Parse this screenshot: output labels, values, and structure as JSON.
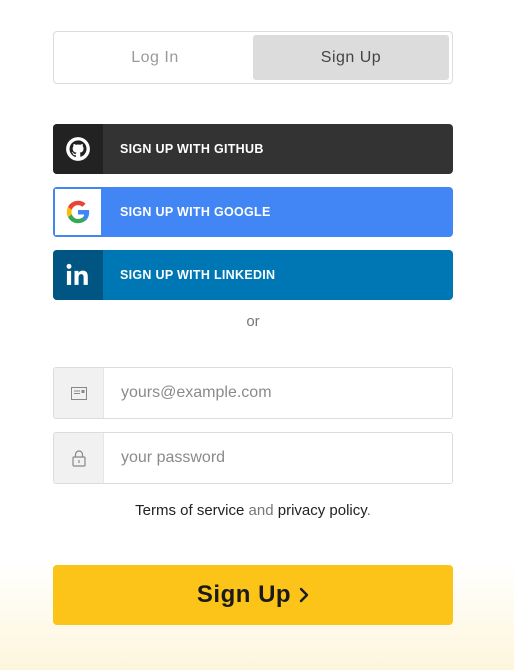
{
  "tabs": {
    "login": "Log In",
    "signup": "Sign Up"
  },
  "social": {
    "github": "SIGN UP WITH GITHUB",
    "google": "SIGN UP WITH GOOGLE",
    "linkedin": "SIGN UP WITH LINKEDIN",
    "icons": [
      "github-icon",
      "google-icon",
      "linkedin-icon"
    ],
    "colors": {
      "github": "#333333",
      "google": "#4285f4",
      "linkedin": "#0077b5"
    }
  },
  "separator": "or",
  "form": {
    "email_placeholder": "yours@example.com",
    "password_placeholder": "your password",
    "email_value": "",
    "password_value": ""
  },
  "terms": {
    "tos": "Terms of service",
    "and": " and ",
    "privacy": "privacy policy",
    "period": "."
  },
  "submit": {
    "label": "Sign Up",
    "color": "#fcc419"
  }
}
